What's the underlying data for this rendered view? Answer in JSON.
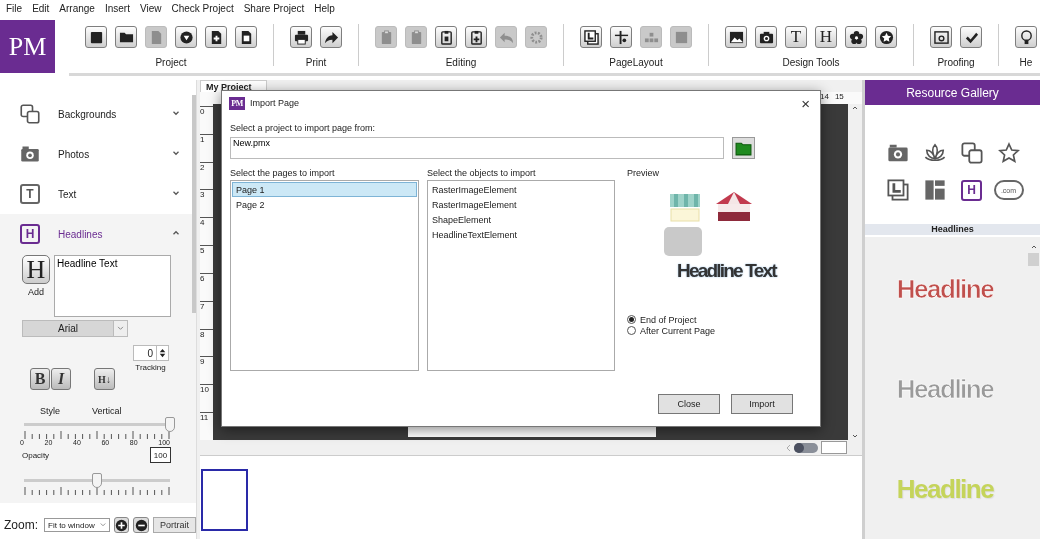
{
  "menu": [
    "File",
    "Edit",
    "Arrange",
    "Insert",
    "View",
    "Check Project",
    "Share Project",
    "Help"
  ],
  "toolbar": {
    "logo": "PM",
    "groups": [
      {
        "label": "Project",
        "tools": [
          {
            "disabled": false
          },
          {
            "disabled": false
          },
          {
            "disabled": true
          },
          {
            "disabled": false
          },
          {
            "disabled": false
          },
          {
            "disabled": false
          }
        ]
      },
      {
        "label": "Print",
        "tools": [
          {
            "disabled": false
          },
          {
            "disabled": false
          }
        ]
      },
      {
        "label": "Editing",
        "tools": [
          {
            "disabled": true
          },
          {
            "disabled": true
          },
          {
            "disabled": false
          },
          {
            "disabled": false
          },
          {
            "disabled": true
          },
          {
            "disabled": true
          }
        ]
      },
      {
        "label": "PageLayout",
        "tools": [
          {
            "disabled": false
          },
          {
            "disabled": false
          },
          {
            "disabled": true
          },
          {
            "disabled": true
          }
        ]
      },
      {
        "label": "Design Tools",
        "tools": [
          {
            "disabled": false
          },
          {
            "disabled": false
          },
          {
            "disabled": false,
            "glyph": "T"
          },
          {
            "disabled": false,
            "glyph": "H"
          },
          {
            "disabled": false
          },
          {
            "disabled": false
          }
        ]
      },
      {
        "label": "Proofing",
        "tools": [
          {
            "disabled": false
          },
          {
            "disabled": false
          }
        ]
      },
      {
        "label": "He",
        "tools": [
          {
            "disabled": false
          }
        ]
      }
    ]
  },
  "left_panel": {
    "sections": [
      {
        "label": "Backgrounds",
        "expanded": false
      },
      {
        "label": "Photos",
        "expanded": false
      },
      {
        "label": "Text",
        "expanded": false,
        "glyph": "T"
      },
      {
        "label": "Headlines",
        "expanded": true,
        "glyph": "H"
      }
    ],
    "headline_editor": {
      "add_glyph": "H",
      "add_label": "Add",
      "text": "Headline Text",
      "font": "Arial",
      "tracking": "0",
      "tracking_label": "Tracking",
      "style_buttons": [
        "B",
        "I"
      ],
      "vertical_button": "H↓",
      "style_label": "Style",
      "vertical_label": "Vertical",
      "opacity": {
        "level": 1,
        "ticks": [
          "0",
          "20",
          "40",
          "60",
          "80",
          "100"
        ],
        "label": "Opacity",
        "value": "100"
      },
      "second_slider": {
        "level": 0.5
      }
    },
    "zoom": {
      "label": "Zoom:",
      "select": "Fit to window",
      "orientation": "Portrait"
    }
  },
  "canvas": {
    "tab": "My Project",
    "toggle_on": false,
    "top_ruler": [
      "14",
      "15"
    ],
    "left_ruler": [
      "0",
      "1",
      "2",
      "3",
      "4",
      "5",
      "6",
      "7",
      "8",
      "9",
      "10",
      "11"
    ]
  },
  "gallery": {
    "title": "Resource Gallery",
    "icons": [
      {
        "selected": false
      },
      {
        "selected": false
      },
      {
        "selected": false
      },
      {
        "selected": false
      },
      {
        "selected": false
      },
      {
        "selected": false
      },
      {
        "selected": true,
        "glyph": "H"
      },
      {
        "selected": false,
        "glyph": ".com"
      }
    ],
    "category": "Headlines",
    "headlines": [
      {
        "text": "Headline",
        "kind": "outline",
        "color": "#c0504d"
      },
      {
        "text": "Headline",
        "kind": "outline",
        "color": "#9a9a9a"
      },
      {
        "text": "Headline",
        "kind": "solid",
        "color": "#c5d45a"
      }
    ]
  },
  "dialog": {
    "icon_text": "PM",
    "title": "Import Page",
    "close": "×",
    "source_label": "Select a project to import page from:",
    "source_value": "New.pmx",
    "pages_label": "Select the pages to import",
    "pages": [
      {
        "label": "Page 1",
        "selected": true
      },
      {
        "label": "Page 2",
        "selected": false
      }
    ],
    "objects_label": "Select the objects to import",
    "objects": [
      "RasterImageElement",
      "RasterImageElement",
      "ShapeElement",
      "HeadlineTextElement"
    ],
    "preview_label": "Preview",
    "preview_headline": "Headline Text",
    "placements": [
      {
        "label": "End of Project",
        "selected": true
      },
      {
        "label": "After Current Page",
        "selected": false
      }
    ],
    "buttons": [
      "Close",
      "Import"
    ]
  }
}
